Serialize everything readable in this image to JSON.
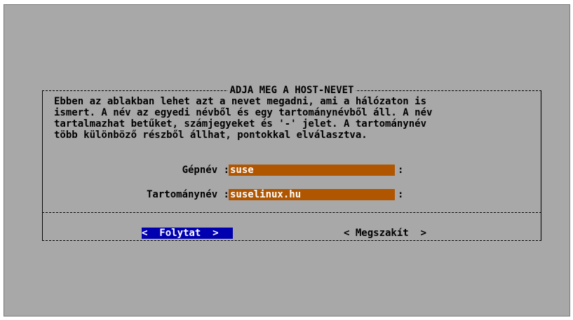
{
  "dialog": {
    "title": "ADJA MEG A HOST-NEVET",
    "description": "Ebben az ablakban lehet azt a nevet megadni, ami a hálózaton is\nismert. A név az egyedi névből és egy tartománynévből áll. A név\ntartalmazhat betűket, számjegyeket és '-' jelet. A tartománynév\ntöbb különböző részből állhat, pontokkal elválasztva.",
    "fields": [
      {
        "label": "Gépnév :",
        "value": "suse"
      },
      {
        "label": "Tartománynév :",
        "value": "suselinux.hu"
      }
    ],
    "field_end": ":",
    "buttons": {
      "ok": "<  Folytat  >",
      "cancel": "< Megszakít  >"
    }
  },
  "colors": {
    "background": "#a8a8a8",
    "input_field": "#b05500",
    "selected_button": "#0000b0"
  }
}
